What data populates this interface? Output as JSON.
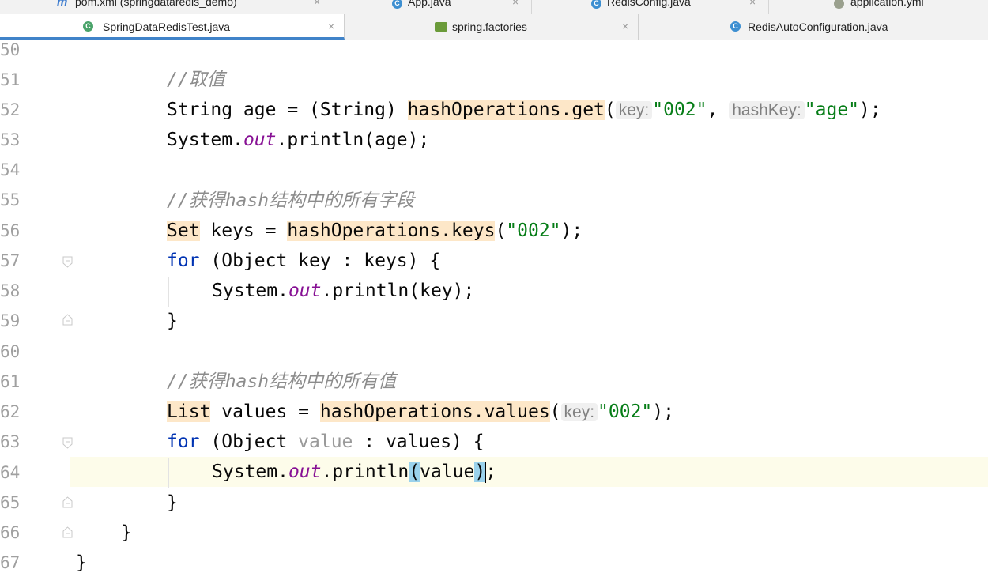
{
  "tabs_row1": [
    {
      "label": "pom.xml (springdataredis_demo)",
      "icon": "maven-icon",
      "closable": true
    },
    {
      "label": "App.java",
      "icon": "java-class-icon",
      "closable": true
    },
    {
      "label": "RedisConfig.java",
      "icon": "java-class-icon",
      "closable": true
    },
    {
      "label": "application.yml",
      "icon": "yaml-icon",
      "closable": false
    }
  ],
  "tabs_row2": [
    {
      "label": "SpringDataRedisTest.java",
      "icon": "test-class-icon",
      "active": true,
      "closable": true
    },
    {
      "label": "spring.factories",
      "icon": "factories-icon",
      "active": false,
      "closable": true
    },
    {
      "label": "RedisAutoConfiguration.java",
      "icon": "java-class-icon",
      "active": false,
      "closable": false
    }
  ],
  "line_numbers": [
    "50",
    "51",
    "52",
    "53",
    "54",
    "55",
    "56",
    "57",
    "58",
    "59",
    "60",
    "61",
    "62",
    "63",
    "64",
    "65",
    "66",
    "67"
  ],
  "code": {
    "l51_comment": "//取值",
    "l52_type": "String age = (String) ",
    "l52_call": "hashOperations.get",
    "l52_open": "(",
    "l52_hint1": "key:",
    "l52_arg1": "\"002\"",
    "l52_comma": ", ",
    "l52_hint2": "hashKey:",
    "l52_arg2": "\"age\"",
    "l52_end": ");",
    "l53_a": "System.",
    "l53_out": "out",
    "l53_b": ".println(age);",
    "l55_comment": "//获得hash结构中的所有字段",
    "l56_type": "Set",
    "l56_mid": " keys = ",
    "l56_call": "hashOperations.keys",
    "l56_open": "(",
    "l56_arg": "\"002\"",
    "l56_end": ");",
    "l57_kw": "for",
    "l57_rest": " (Object key : keys) {",
    "l58_a": "System.",
    "l58_out": "out",
    "l58_b": ".println(key);",
    "l59": "}",
    "l61_comment": "//获得hash结构中的所有值",
    "l62_type": "List",
    "l62_mid": " values = ",
    "l62_call": "hashOperations.values",
    "l62_open": "(",
    "l62_hint": "key:",
    "l62_arg": "\"002\"",
    "l62_end": ");",
    "l63_kw": "for",
    "l63_a": " (Object ",
    "l63_var": "value",
    "l63_b": " : values) {",
    "l64_a": "System.",
    "l64_out": "out",
    "l64_b": ".println",
    "l64_open": "(",
    "l64_arg": "value",
    "l64_close": ")",
    "l64_end": ";",
    "l65": "}",
    "l66": "}",
    "l67": "}"
  },
  "colors": {
    "keyword": "#0033b3",
    "string": "#067d17",
    "comment": "#8c8c8c",
    "field": "#871094",
    "highlight": "#fde7c8",
    "active_tab_underline": "#4083c9"
  }
}
